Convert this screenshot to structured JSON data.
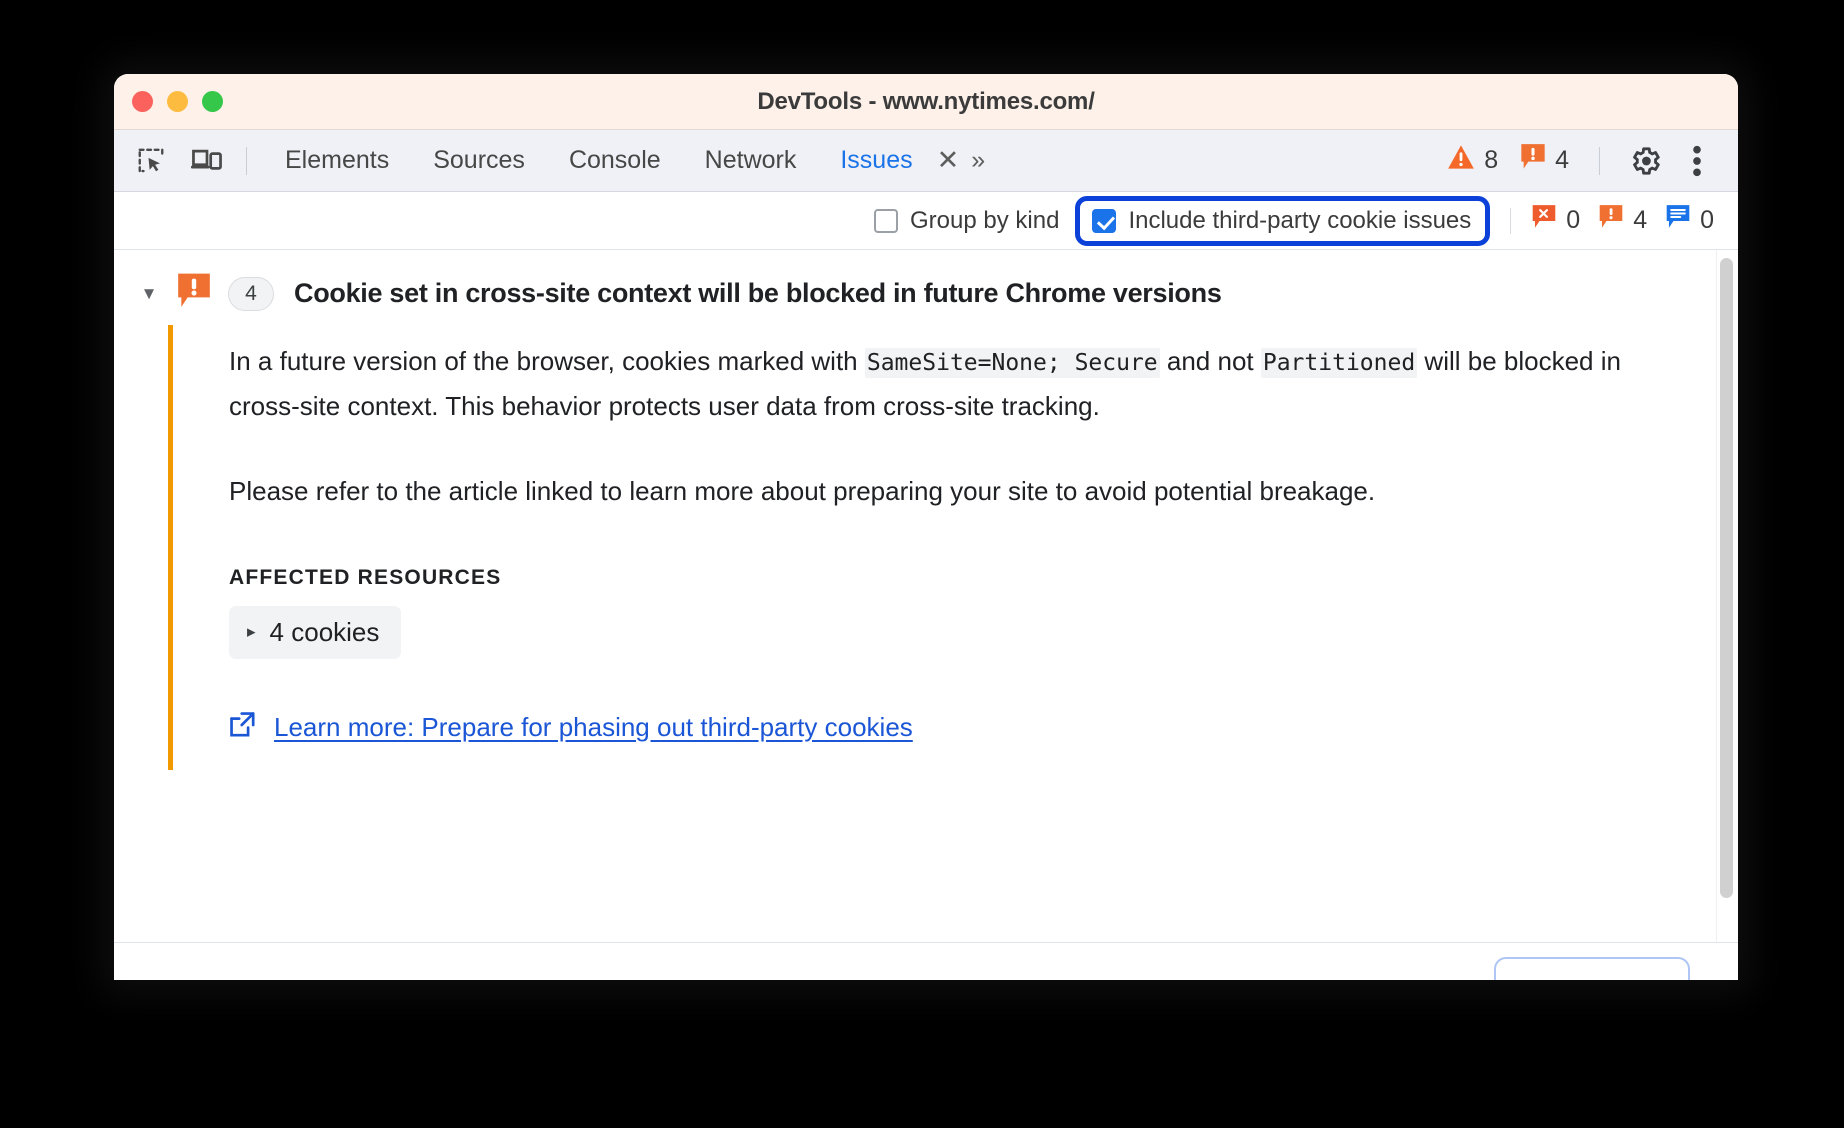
{
  "window": {
    "title": "DevTools - www.nytimes.com/",
    "traffic_lights": [
      "close",
      "minimize",
      "zoom"
    ]
  },
  "toolbar": {
    "inspect_icon": "inspect-element-icon",
    "device_icon": "device-toolbar-icon",
    "tabs": [
      {
        "label": "Elements",
        "active": false
      },
      {
        "label": "Sources",
        "active": false
      },
      {
        "label": "Console",
        "active": false
      },
      {
        "label": "Network",
        "active": false
      },
      {
        "label": "Issues",
        "active": true
      }
    ],
    "close_tab_label": "✕",
    "more_tabs_label": "»",
    "warning_count": "8",
    "issue_count": "4",
    "settings_icon": "gear-icon",
    "more_options_icon": "kebab-menu-icon"
  },
  "filter_bar": {
    "group_by_kind": {
      "label": "Group by kind",
      "checked": false
    },
    "include_third_party": {
      "label": "Include third-party cookie issues",
      "checked": true,
      "highlight_color": "#0b41d8"
    },
    "counts": [
      {
        "icon": "error-bubble-icon",
        "value": "0",
        "color": "#ee5b2c"
      },
      {
        "icon": "warning-bubble-icon",
        "value": "4",
        "color": "#f07032"
      },
      {
        "icon": "info-bubble-icon",
        "value": "0",
        "color": "#1a73e8"
      }
    ]
  },
  "issue": {
    "disclosure_state": "expanded",
    "severity_icon": "warning-bubble-icon",
    "severity_color": "#f07032",
    "aggregate_count": "4",
    "title": "Cookie set in cross-site context will be blocked in future Chrome versions",
    "accent_color": "#f29900",
    "paragraph1": {
      "part1": "In a future version of the browser, cookies marked with ",
      "code1": "SameSite=None; Secure",
      "part2": " and not ",
      "code2": "Partitioned",
      "part3": " will be blocked in cross-site context. This behavior protects user data from cross-site tracking."
    },
    "paragraph2": "Please refer to the article linked to learn more about preparing your site to avoid potential breakage.",
    "affected_resources_label": "AFFECTED RESOURCES",
    "resource_chip": {
      "arrow": "▸",
      "label": "4 cookies"
    },
    "learn_more": {
      "icon": "external-link-icon",
      "label": "Learn more: Prepare for phasing out third-party cookies"
    }
  }
}
